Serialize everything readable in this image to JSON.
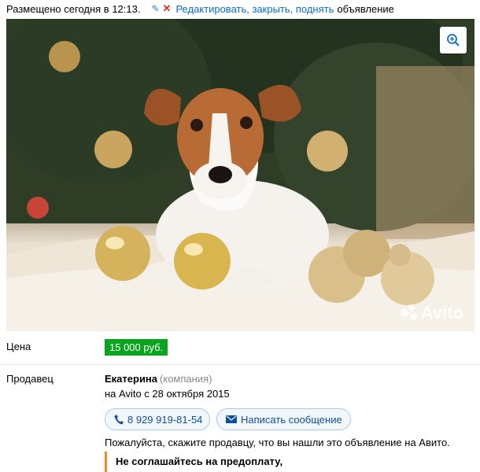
{
  "header": {
    "posted": "Размещено сегодня в 12:13.",
    "edit_link": "Редактировать, закрыть, поднять",
    "edit_tail": "объявление"
  },
  "photo": {
    "subject": "Jack Russell terrier puppy with golden Christmas ornaments",
    "watermark": "Avito"
  },
  "price": {
    "label": "Цена",
    "value": "15 000 руб.",
    "color": "#0aa51e"
  },
  "seller": {
    "label": "Продавец",
    "name": "Екатерина",
    "type": "(компания)",
    "since": "на Avito с 28 октября 2015"
  },
  "actions": {
    "phone": "8 929 919-81-54",
    "message": "Написать сообщение"
  },
  "note": "Пожалуйста, скажите продавцу, что вы нашли это объявление на Авито.",
  "warning": "Не соглашайтесь на предоплату,",
  "colors": {
    "link": "#0b6cd0",
    "accent_warning": "#f08b2a",
    "delete_red": "#e0312b"
  }
}
